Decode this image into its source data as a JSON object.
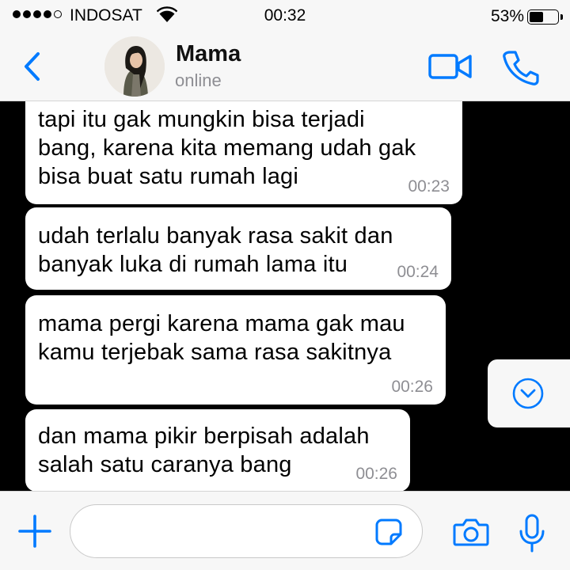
{
  "status_bar": {
    "carrier": "INDOSAT",
    "time": "00:32",
    "battery_percent": "53%",
    "battery_level": 0.53,
    "signal_bars": 4,
    "signal_max": 5,
    "icons": [
      "signal-dots-icon",
      "wifi-icon",
      "battery-icon"
    ]
  },
  "header": {
    "contact_name": "Mama",
    "contact_status": "online",
    "icons": [
      "back-chevron-icon",
      "video-call-icon",
      "phone-call-icon"
    ]
  },
  "messages": [
    {
      "text": "tapi itu gak mungkin bisa terjadi\nbang, karena kita memang udah gak\nbisa buat satu rumah lagi",
      "time": "00:23"
    },
    {
      "text": "udah terlalu banyak rasa sakit dan\nbanyak luka di rumah lama itu",
      "time": "00:24"
    },
    {
      "text": "mama pergi karena mama gak mau\nkamu terjebak sama rasa sakitnya",
      "time": "00:26"
    },
    {
      "text": "dan mama pikir berpisah adalah\nsalah satu caranya bang",
      "time": "00:26"
    }
  ],
  "composer": {
    "placeholder": "",
    "value": "",
    "icons": [
      "plus-icon",
      "sticker-icon",
      "camera-icon",
      "microphone-icon",
      "scroll-down-icon"
    ]
  },
  "colors": {
    "accent": "#007aff",
    "bar_background": "#f7f7f7",
    "chat_background": "#000000",
    "bubble": "#ffffff",
    "timestamp": "#8e8e93"
  }
}
